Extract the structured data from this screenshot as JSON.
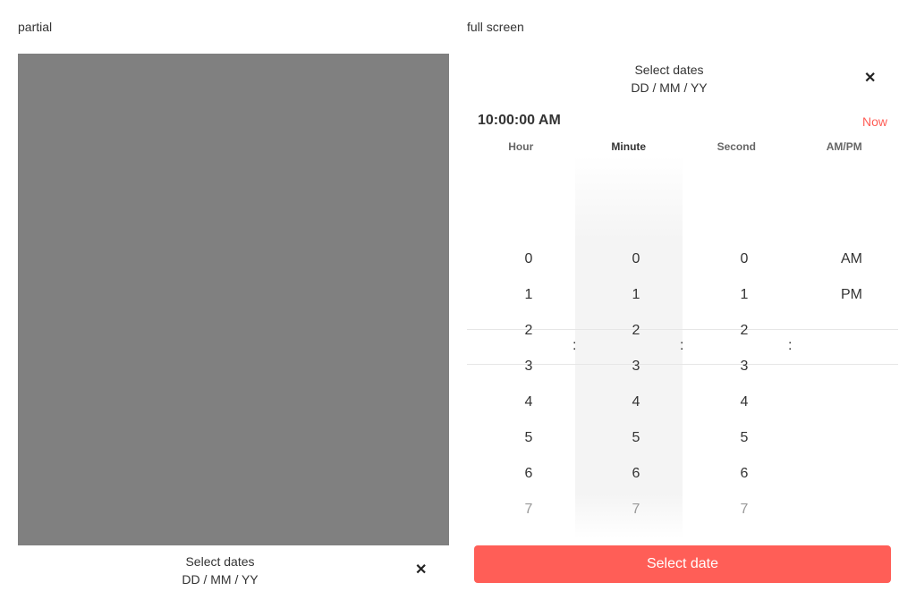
{
  "captions": {
    "partial": "partial",
    "full": "full screen"
  },
  "left_panel": {
    "title": "Select dates",
    "subtitle": "DD / MM / YY",
    "close_glyph": "✕"
  },
  "right_panel": {
    "title": "Select dates",
    "subtitle": "DD / MM / YY",
    "close_glyph": "✕",
    "time_value": "10:00:00 AM",
    "now_label": "Now",
    "columns": [
      "Hour",
      "Minute",
      "Second",
      "AM/PM"
    ],
    "hours": [
      "0",
      "1",
      "2",
      "3",
      "4",
      "5",
      "6",
      "7"
    ],
    "minutes": [
      "0",
      "1",
      "2",
      "3",
      "4",
      "5",
      "6",
      "7"
    ],
    "seconds": [
      "0",
      "1",
      "2",
      "3",
      "4",
      "5",
      "6",
      "7"
    ],
    "ampm": [
      "AM",
      "PM"
    ],
    "separator": ":",
    "select_button": "Select date"
  },
  "colors": {
    "accent": "#ff5e57",
    "overlay": "#808080"
  }
}
